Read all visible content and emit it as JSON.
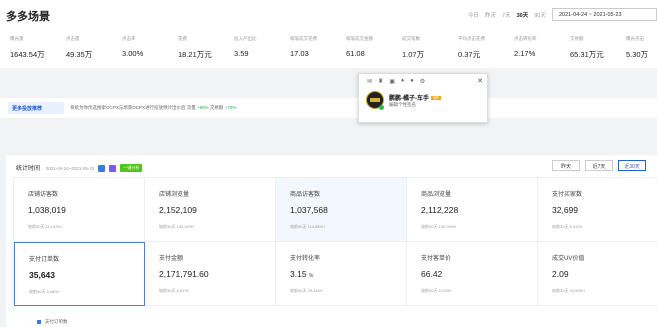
{
  "header": {
    "title": "多多场景",
    "periods": [
      "今日",
      "昨天",
      "7天",
      "30天",
      "90天"
    ],
    "active_period": "30天",
    "date_range": "2021-04-24 ~ 2021-05-23"
  },
  "metrics": [
    {
      "label": "曝光量",
      "value": "1643.54万"
    },
    {
      "label": "点击量",
      "value": "49.35万"
    },
    {
      "label": "点击率",
      "value": "3.00%"
    },
    {
      "label": "花费",
      "value": "18.21万元"
    },
    {
      "label": "投入产出比",
      "value": "3.59"
    },
    {
      "label": "每笔成交花费",
      "value": "17.03"
    },
    {
      "label": "每笔成交金额",
      "value": "61.08"
    },
    {
      "label": "成交笔数",
      "value": "1.07万"
    },
    {
      "label": "平均点击花费",
      "value": "0.37元"
    },
    {
      "label": "点击转化率",
      "value": "2.17%"
    },
    {
      "label": "交易额",
      "value": "65.31万元"
    },
    {
      "label": "曝光点击",
      "value": "5.30万"
    }
  ],
  "promo": {
    "tag": "更多投放推荐",
    "text": "系统为你优选搜索OCPX与场景OCPX进行投放预计出价后 流量",
    "gain1": "+90%",
    "mid": "交易额",
    "gain2": "+73%"
  },
  "popup": {
    "name": "鹏鹏-橘子-车手",
    "badge": "VIP",
    "signature": "编辑个性签名",
    "icons": [
      "mail-icon",
      "shirt-icon",
      "folder-icon",
      "gift-icon",
      "mic-icon",
      "settings-icon"
    ]
  },
  "stats": {
    "title": "统计时间",
    "date_range": "2021-04-24~2021-05-23",
    "analysis_btn": "一键分析",
    "range_buttons": [
      "昨天",
      "近7天",
      "近30天"
    ],
    "compare_label": "较前30天",
    "cells": [
      {
        "label": "店铺访客数",
        "value": "1,038,019",
        "unit": "",
        "change": "114.87%"
      },
      {
        "label": "店铺浏览量",
        "value": "2,152,109",
        "unit": "",
        "change": "130.34%"
      },
      {
        "label": "商品访客数",
        "value": "1,037,568",
        "unit": "",
        "change": "114.83%"
      },
      {
        "label": "商品浏览量",
        "value": "2,112,228",
        "unit": "",
        "change": "130.05%"
      },
      {
        "label": "支付买家数",
        "value": "32,699",
        "unit": "",
        "change": "5.41%"
      },
      {
        "label": "支付订单数",
        "value": "35,643",
        "unit": "",
        "change": "5.48%"
      },
      {
        "label": "支付金额",
        "value": "2,171,791.60",
        "unit": "",
        "change": "5.51%"
      },
      {
        "label": "支付转化率",
        "value": "3.15",
        "unit": "%",
        "change": "29.24%"
      },
      {
        "label": "支付客单价",
        "value": "66.42",
        "unit": "",
        "change": "0.10%"
      },
      {
        "label": "成交UV价值",
        "value": "2.09",
        "unit": "",
        "change": "22.93%"
      }
    ],
    "legend": "支付订单数"
  },
  "colors": {
    "accent": "#1f5fcf",
    "up": "#e64340",
    "green": "#52c41a"
  }
}
